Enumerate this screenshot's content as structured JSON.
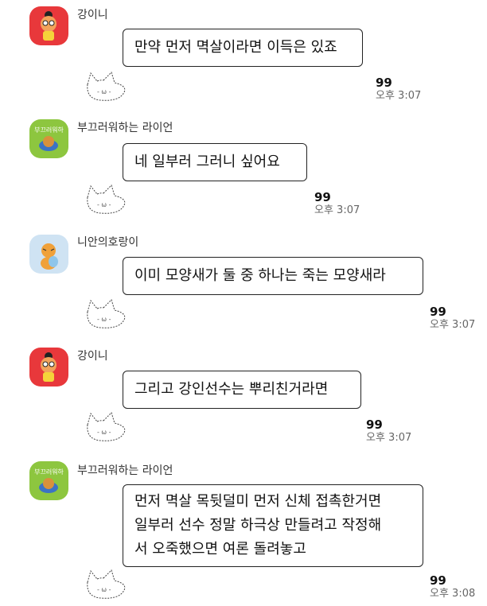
{
  "messages": [
    {
      "sender": "강이니",
      "avatar": "kakao-apeach-icon",
      "lines": [
        "만약 먼저 멱살이라면 이득은 있죠"
      ],
      "unread": "99",
      "time": "오후 3:07"
    },
    {
      "sender": "부끄러워하는 라이언",
      "avatar": "shy-lion-icon",
      "avatar_caption": "부끄러워하",
      "lines": [
        "네 일부러 그러니 싶어요"
      ],
      "unread": "99",
      "time": "오후 3:07"
    },
    {
      "sender": "니안의호랑이",
      "avatar": "tiger-icon",
      "lines": [
        "이미 모양새가 둘 중 하나는 죽는 모양새라"
      ],
      "unread": "99",
      "time": "오후 3:07"
    },
    {
      "sender": "강이니",
      "avatar": "kakao-apeach-icon",
      "lines": [
        "그리고 강인선수는 뿌리친거라면"
      ],
      "unread": "99",
      "time": "오후 3:07"
    },
    {
      "sender": "부끄러워하는 라이언",
      "avatar": "shy-lion-icon",
      "avatar_caption": "부끄러워하",
      "lines": [
        "먼저 멱살 목뒷덜미 먼저 신체 접촉한거면",
        "일부러 선수 정말 하극상 만들려고 작정해",
        "서 오죽했으면 여론 돌려놓고"
      ],
      "unread": "99",
      "time": "오후 3:08"
    }
  ],
  "colors": {
    "avatar_red": "#e8383b",
    "avatar_green": "#8dc63f",
    "avatar_blue": "#cfe3f3"
  }
}
